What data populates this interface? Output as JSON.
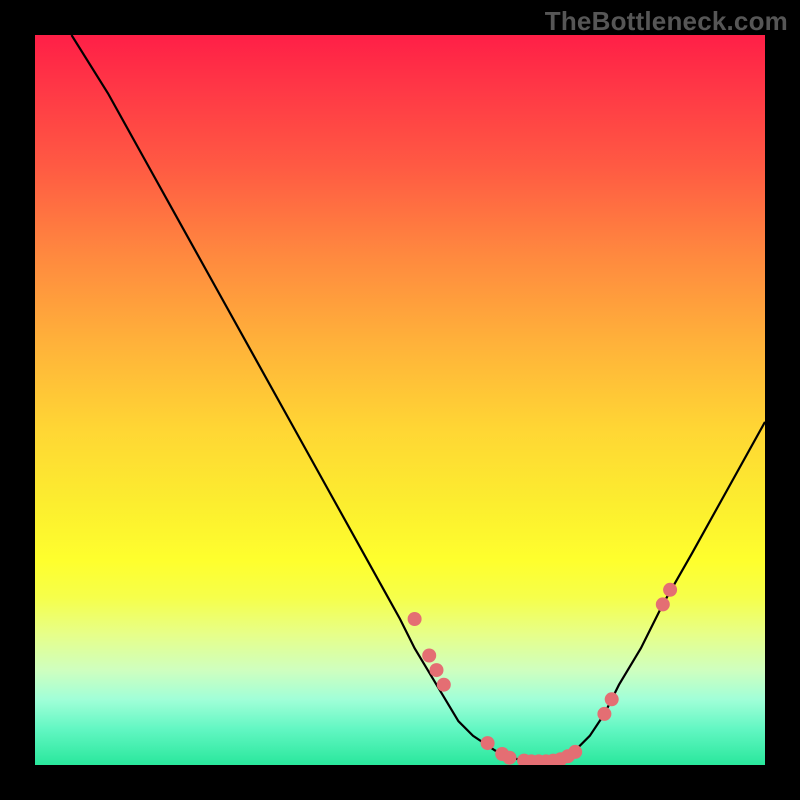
{
  "watermark": "TheBottleneck.com",
  "chart_data": {
    "type": "line",
    "title": "",
    "xlabel": "",
    "ylabel": "",
    "xlim": [
      0,
      100
    ],
    "ylim": [
      0,
      100
    ],
    "series": [
      {
        "name": "bottleneck-curve",
        "x": [
          5,
          10,
          15,
          20,
          25,
          30,
          35,
          40,
          45,
          50,
          52,
          55,
          58,
          60,
          63,
          65,
          68,
          70,
          72,
          74,
          76,
          78,
          80,
          83,
          86,
          90,
          95,
          100
        ],
        "y": [
          100,
          92,
          83,
          74,
          65,
          56,
          47,
          38,
          29,
          20,
          16,
          11,
          6,
          4,
          2,
          1,
          0.5,
          0.5,
          0.8,
          2,
          4,
          7,
          11,
          16,
          22,
          29,
          38,
          47
        ]
      }
    ],
    "scatter_points": {
      "name": "highlighted-points",
      "color": "#e46e73",
      "points": [
        {
          "x": 52,
          "y": 20
        },
        {
          "x": 54,
          "y": 15
        },
        {
          "x": 55,
          "y": 13
        },
        {
          "x": 56,
          "y": 11
        },
        {
          "x": 62,
          "y": 3
        },
        {
          "x": 64,
          "y": 1.5
        },
        {
          "x": 65,
          "y": 1
        },
        {
          "x": 67,
          "y": 0.6
        },
        {
          "x": 68,
          "y": 0.5
        },
        {
          "x": 69,
          "y": 0.5
        },
        {
          "x": 70,
          "y": 0.5
        },
        {
          "x": 71,
          "y": 0.6
        },
        {
          "x": 72,
          "y": 0.8
        },
        {
          "x": 73,
          "y": 1.2
        },
        {
          "x": 74,
          "y": 1.8
        },
        {
          "x": 78,
          "y": 7
        },
        {
          "x": 79,
          "y": 9
        },
        {
          "x": 86,
          "y": 22
        },
        {
          "x": 87,
          "y": 24
        }
      ]
    },
    "gradient_stops": [
      {
        "pos": 0,
        "color": "#ff1f47"
      },
      {
        "pos": 50,
        "color": "#ffd030"
      },
      {
        "pos": 75,
        "color": "#feff2d"
      },
      {
        "pos": 100,
        "color": "#29e79c"
      }
    ]
  }
}
